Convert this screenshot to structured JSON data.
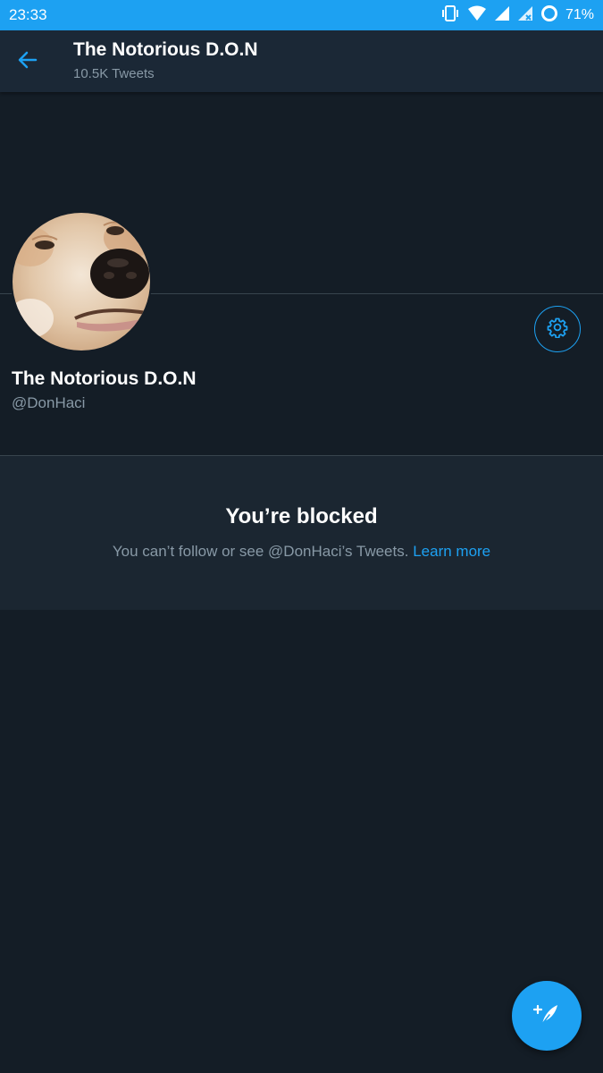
{
  "status_bar": {
    "time": "23:33",
    "battery": "71%",
    "icons": [
      "vibrate-icon",
      "wifi-icon",
      "signal-icon",
      "signal-no-data-icon",
      "battery-ring-icon"
    ]
  },
  "app_bar": {
    "title": "The Notorious D.O.N",
    "subtitle": "10.5K Tweets",
    "back_icon": "arrow-back-icon"
  },
  "profile": {
    "display_name": "The Notorious D.O.N",
    "handle": "@DonHaci",
    "avatar": "dog-face-avatar",
    "settings_icon": "gear-icon"
  },
  "blocked": {
    "title": "You’re blocked",
    "message": "You can’t follow or see @DonHaci’s Tweets.",
    "link": "Learn more"
  },
  "fab": {
    "icon": "compose-tweet-icon"
  },
  "colors": {
    "accent": "#1da1f2",
    "background": "#141d26",
    "surface": "#1b2836",
    "muted_text": "#8899a6"
  }
}
